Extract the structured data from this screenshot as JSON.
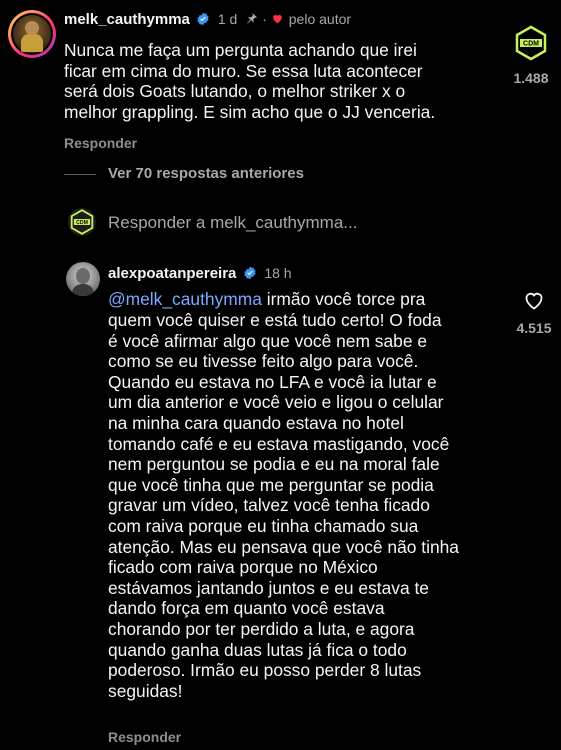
{
  "colors": {
    "background": "#000000",
    "text": "#f5f5f5",
    "muted": "#a8a8a8",
    "mention": "#7aa8ff",
    "heart_red": "#ff3040",
    "verified_blue": "#3897f0",
    "badge_green": "#c9f25a"
  },
  "comments": [
    {
      "username": "melk_cauthymma",
      "time": "1 d",
      "liked_by_author": "pelo autor",
      "text": "Nunca me faça um pergunta achando que irei\nficar em cima do muro. Se essa luta acontecer\nserá dois Goats lutando, o melhor striker x o\nmelhor grappling. E sim acho que o JJ venceria.",
      "reply_label": "Responder",
      "likes": "1.488"
    },
    {
      "username": "alexpoatanpereira",
      "time": "18 h",
      "mention": "@melk_cauthymma",
      "text_first_line": " irmão você torce pra",
      "text": "quem você quiser e está tudo certo! O foda\né você afirmar algo que você nem sabe e\ncomo se eu tivesse feito algo para você.\nQuando eu estava no LFA e você ia lutar e\num dia anterior e você veio e ligou o celular\nna minha cara quando estava no hotel\ntomando café e eu estava mastigando, você\nnem perguntou se podia e eu na moral fale\nque você tinha que me perguntar se podia\ngravar um vídeo, talvez você tenha ficado\ncom raiva porque eu tinha chamado sua\natenção. Mas eu pensava que você não tinha\nficado com raiva porque no México\nestávamos jantando juntos e eu estava te\ndando força em quanto você estava\nchorando por ter perdido a luta, e agora\nquando ganha duas lutas já fica o todo\npoderoso. Irmão eu posso perder 8 lutas\nseguidas!",
      "reply_label": "Responder",
      "likes": "4.515"
    }
  ],
  "thread": {
    "view_previous": "Ver 70 respostas anteriores",
    "reply_prompt": "Responder a melk_cauthymma..."
  },
  "badge": {
    "text": "CDM"
  },
  "icons": {
    "pin": "pin-icon",
    "heart_filled": "heart-filled-icon",
    "heart_outline": "heart-outline-icon",
    "verified": "verified-badge-icon",
    "badge": "cdm-logo-icon"
  }
}
